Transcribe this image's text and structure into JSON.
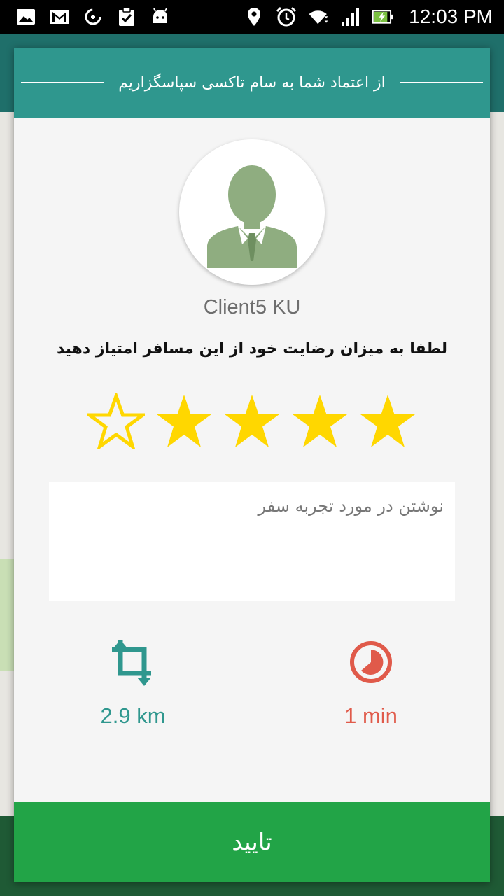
{
  "status_bar": {
    "time": "12:03 PM",
    "left_icons": [
      "image-icon",
      "gmail-icon",
      "data-saver-icon",
      "clipboard-check-icon",
      "android-icon"
    ],
    "right_icons": [
      "location-icon",
      "alarm-icon",
      "wifi-icon",
      "signal-icon",
      "battery-charging-icon"
    ]
  },
  "dialog": {
    "header_title": "از اعتماد شما به سام تاکسی سپاسگزاریم",
    "client_name": "Client5 KU",
    "rating_prompt": "لطفا به میزان رضایت خود از این مسافر امتیاز دهید",
    "rating": {
      "value": 4,
      "max": 5
    },
    "comment": {
      "placeholder": "نوشتن در مورد تجربه سفر",
      "value": ""
    },
    "distance": "2.9 km",
    "duration": "1 min",
    "confirm_label": "تایید"
  },
  "colors": {
    "header": "#2f978e",
    "star": "#ffd700",
    "distance": "#2f978e",
    "duration": "#e05a4a",
    "confirm": "#22a447"
  }
}
